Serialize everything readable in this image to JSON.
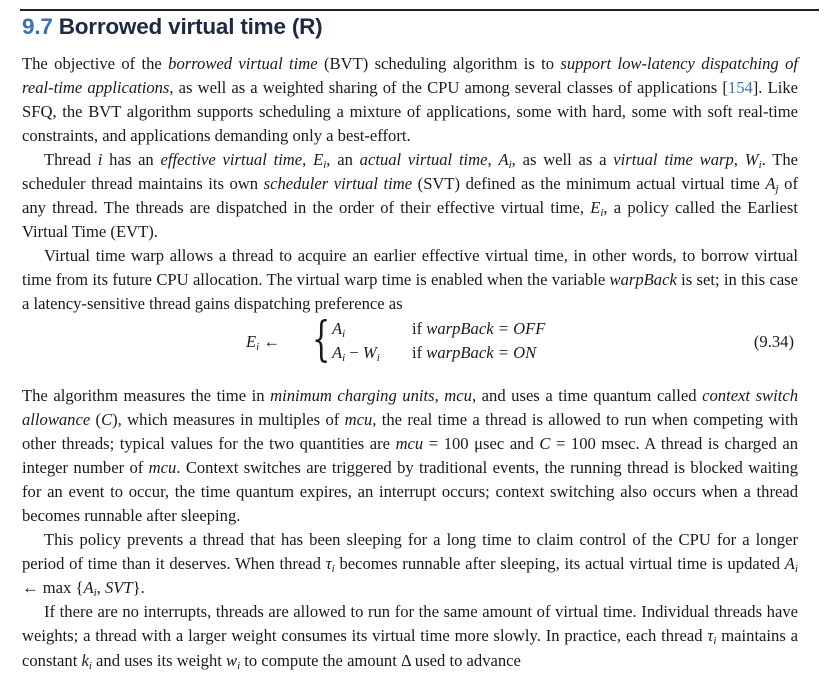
{
  "section": {
    "number": "9.7",
    "title": "Borrowed virtual time (R)"
  },
  "para1": {
    "t1": "The objective of the ",
    "i1": "borrowed virtual time",
    "t2": " (BVT) scheduling algorithm is to ",
    "i2": "support low-latency dispatching of real-time applications",
    "t3": ", as well as a weighted sharing of the CPU among several classes of applications [",
    "cite": "154",
    "t4": "]. Like SFQ, the BVT algorithm supports scheduling a mixture of applications, some with hard, some with soft real-time constraints, and applications demanding only a best-effort."
  },
  "para2": {
    "t1": "Thread ",
    "v_i": "i",
    "t2": " has an ",
    "i1": "effective virtual time",
    "t3": ", ",
    "v_E": "E",
    "sub_i": "i",
    "t4": ", an ",
    "i2": "actual virtual time",
    "t5": ", ",
    "v_A": "A",
    "t6": ", as well as a ",
    "i3": "virtual time warp",
    "t7": ",",
    "v_W": "W",
    "t8": ". The scheduler thread maintains its own ",
    "i4": "scheduler virtual time",
    "t9": " (SVT) defined as the minimum actual virtual time ",
    "sub_j": "j",
    "t10": " of any thread. The threads are dispatched in the order of their effective virtual time, ",
    "t11": ", a policy called the Earliest Virtual Time (EVT)."
  },
  "para3": {
    "t1": "Virtual time warp allows a thread to acquire an earlier effective virtual time, in other words, to borrow virtual time from its future CPU allocation. The virtual warp time is enabled when the variable ",
    "i1": "warpBack",
    "t2": " is set; in this case a latency-sensitive thread gains dispatching preference as"
  },
  "equation": {
    "lhs": "E",
    "lhs_sub": "i",
    "arrow": "←",
    "brace": "{",
    "case1_expr": "A",
    "case1_sub": "i",
    "case1_cond_prefix": "if ",
    "case1_cond_var": "warpBack",
    "case1_cond_rest": " = OFF",
    "case2_expr_a": "A",
    "case2_sub_a": "i",
    "case2_minus": " − ",
    "case2_expr_w": "W",
    "case2_sub_w": "i",
    "case2_cond_prefix": "if ",
    "case2_cond_var": "warpBack",
    "case2_cond_rest": " = ON",
    "number": "(9.34)"
  },
  "para4": {
    "t1": "The algorithm measures the time in ",
    "i1": "minimum charging units",
    "t2": ", ",
    "v_mcu": "mcu",
    "t3": ", and uses a time quantum called ",
    "i2": "context switch allowance",
    "t4": " (",
    "v_C": "C",
    "t5": "), which measures in multiples of ",
    "t6": ", the real time a thread is allowed to run when competing with other threads; typical values for the two quantities are ",
    "t7": " = 100 μsec and ",
    "t8": " = 100 msec. A thread is charged an integer number of ",
    "t9": ". Context switches are triggered by traditional events, the running thread is blocked waiting for an event to occur, the time quantum expires, an interrupt occurs; context switching also occurs when a thread becomes runnable after sleeping."
  },
  "para5": {
    "t1": "This policy prevents a thread that has been sleeping for a long time to claim control of the CPU for a longer period of time than it deserves. When thread ",
    "v_tau": "τ",
    "sub_i": "i",
    "t2": " becomes runnable after sleeping, its actual virtual time is updated ",
    "v_A": "A",
    "t3": " ← max {",
    "t4": ", ",
    "v_SVT": "SVT",
    "t5": "}."
  },
  "para6": {
    "t1": "If there are no interrupts, threads are allowed to run for the same amount of virtual time. Individual threads have weights; a thread with a larger weight consumes its virtual time more slowly. In practice, each thread ",
    "v_tau": "τ",
    "sub_i": "i",
    "t2": " maintains a constant ",
    "v_k": "k",
    "t3": " and uses its weight ",
    "v_w": "w",
    "t4": " to compute the amount ",
    "v_delta": "Δ",
    "t5": " used to advance"
  }
}
